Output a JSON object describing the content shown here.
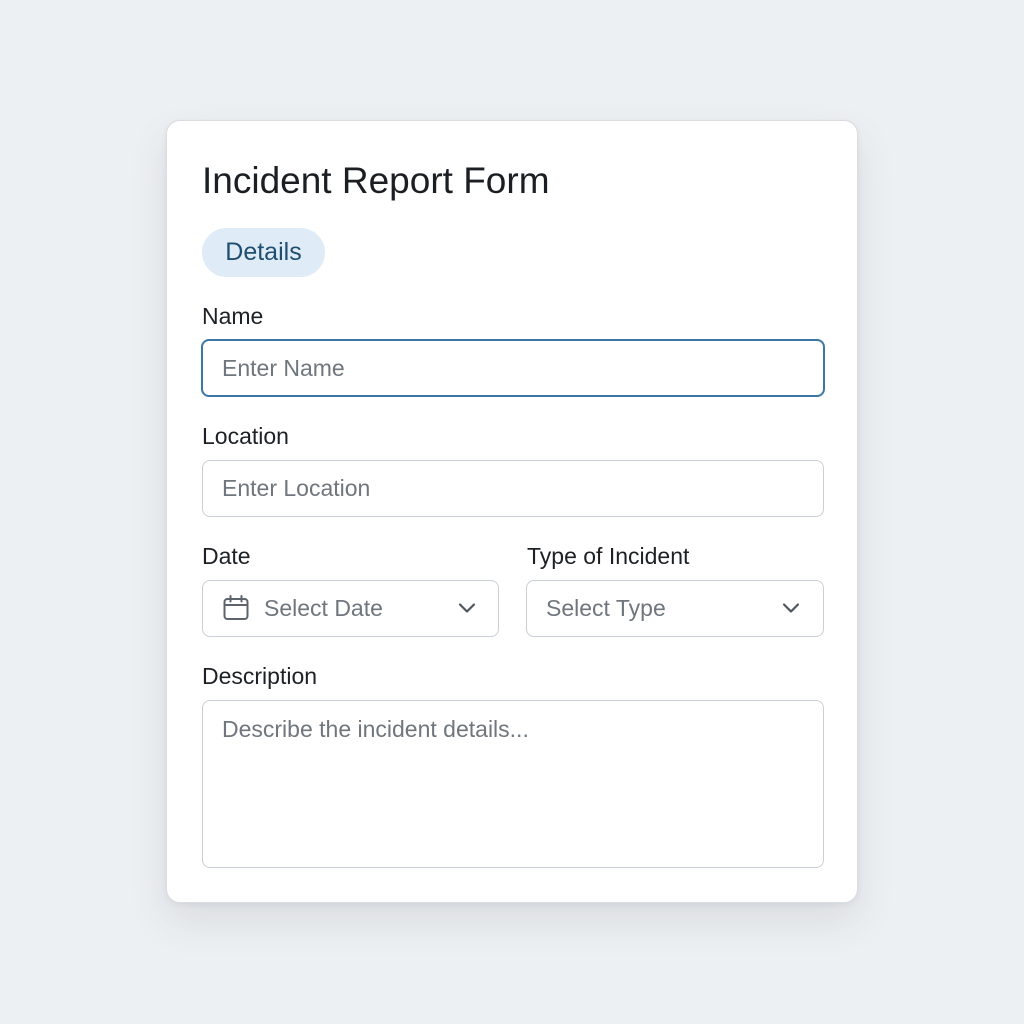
{
  "form": {
    "title": "Incident Report Form",
    "tab_label": "Details",
    "name": {
      "label": "Name",
      "placeholder": "Enter Name",
      "value": ""
    },
    "location": {
      "label": "Location",
      "placeholder": "Enter Location",
      "value": ""
    },
    "date": {
      "label": "Date",
      "placeholder": "Select Date",
      "icon": "calendar-icon",
      "dropdown_icon": "chevron-down-icon"
    },
    "incident_type": {
      "label": "Type of Incident",
      "placeholder": "Select Type",
      "dropdown_icon": "chevron-down-icon"
    },
    "description": {
      "label": "Description",
      "placeholder": "Describe the incident details...",
      "value": ""
    }
  },
  "colors": {
    "background": "#edf0f3",
    "focus_border": "#3a78a4",
    "tab_background": "#dfecf7",
    "tab_text": "#1f4e70",
    "placeholder": "#6f767d"
  }
}
